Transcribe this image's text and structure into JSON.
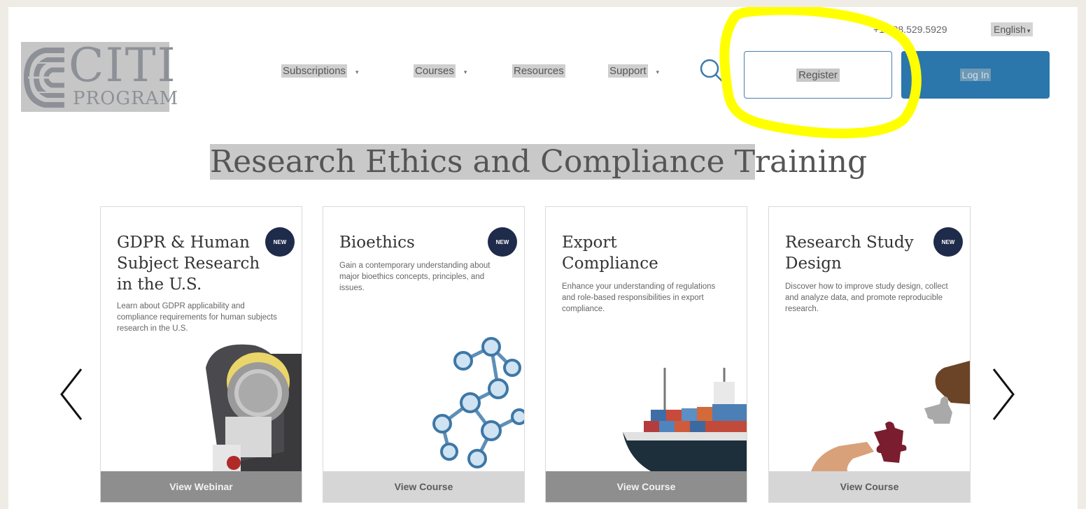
{
  "brand": {
    "logo_main": "CITI",
    "logo_sub": "PROGRAM"
  },
  "topbar": {
    "phone": "+1 888.529.5929",
    "language": "English"
  },
  "nav": {
    "items": [
      {
        "label": "Subscriptions",
        "has_dropdown": true
      },
      {
        "label": "Courses",
        "has_dropdown": true
      },
      {
        "label": "Resources",
        "has_dropdown": false
      },
      {
        "label": "Support",
        "has_dropdown": true
      }
    ],
    "register_label": "Register",
    "login_label": "Log In"
  },
  "headline": {
    "highlighted": "Research Ethics and Compliance T",
    "rest": "raining"
  },
  "carousel": {
    "cards": [
      {
        "title": "GDPR & Human Subject Research in the U.S.",
        "badge": "NEW",
        "description": "Learn about GDPR applicability and compliance requirements for human subjects research in the U.S.",
        "cta": "View Webinar",
        "image": "microphone"
      },
      {
        "title": "Bioethics",
        "badge": "NEW",
        "description": "Gain a contemporary understanding about major bioethics concepts, principles, and issues.",
        "cta": "View Course",
        "image": "molecule"
      },
      {
        "title": "Export Compliance",
        "badge": "",
        "description": "Enhance your understanding of regulations and role-based responsibilities in export compliance.",
        "cta": "View Course",
        "image": "cargo-ship"
      },
      {
        "title": "Research Study Design",
        "badge": "NEW",
        "description": "Discover how to improve study design, collect and analyze data, and promote reproducible research.",
        "cta": "View Course",
        "image": "puzzle-hands"
      }
    ]
  },
  "colors": {
    "login_button": "#2b76ab",
    "register_border": "#4a7fb0",
    "badge": "#1f2b4a",
    "annotation": "#ffff00"
  }
}
